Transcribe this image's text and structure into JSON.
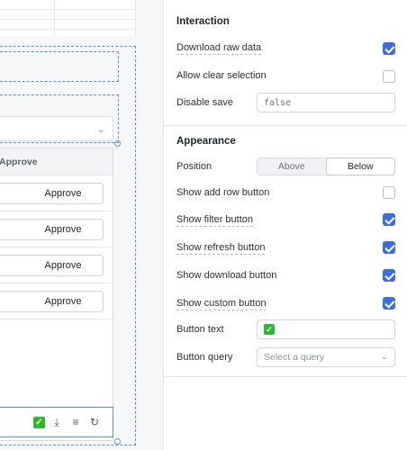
{
  "canvas": {
    "table": {
      "column_header": "Approve",
      "rows": [
        {
          "action_label": "Approve"
        },
        {
          "action_label": "Approve"
        },
        {
          "action_label": "Approve"
        },
        {
          "action_label": "Approve"
        }
      ],
      "toolbar_icons": [
        "checkmark-icon",
        "download-icon",
        "filter-icon",
        "refresh-icon"
      ],
      "toolbar_glyphs": {
        "checkmark": "✓",
        "download": "⤓",
        "filter": "≡",
        "refresh": "↻"
      }
    },
    "select_chevron": "⌄"
  },
  "inspector": {
    "interaction": {
      "title": "Interaction",
      "download_raw_data": {
        "label": "Download raw data",
        "checked": true
      },
      "allow_clear_selection": {
        "label": "Allow clear selection",
        "checked": false
      },
      "disable_save": {
        "label": "Disable save",
        "value": "false"
      }
    },
    "appearance": {
      "title": "Appearance",
      "position": {
        "label": "Position",
        "options": [
          "Above",
          "Below"
        ],
        "selected": "Below"
      },
      "show_add_row_button": {
        "label": "Show add row button",
        "checked": false
      },
      "show_filter_button": {
        "label": "Show filter button",
        "checked": true
      },
      "show_refresh_button": {
        "label": "Show refresh button",
        "checked": true
      },
      "show_download_button": {
        "label": "Show download button",
        "checked": true
      },
      "show_custom_button": {
        "label": "Show custom button",
        "checked": true
      },
      "button_text": {
        "label": "Button text",
        "value": "✓"
      },
      "button_query": {
        "label": "Button query",
        "placeholder": "Select a query",
        "chevron": "⌄"
      }
    }
  },
  "colors": {
    "accent": "#3b6fe0",
    "selection_outline": "#5b8def",
    "emoji_green": "#2eb82e"
  }
}
